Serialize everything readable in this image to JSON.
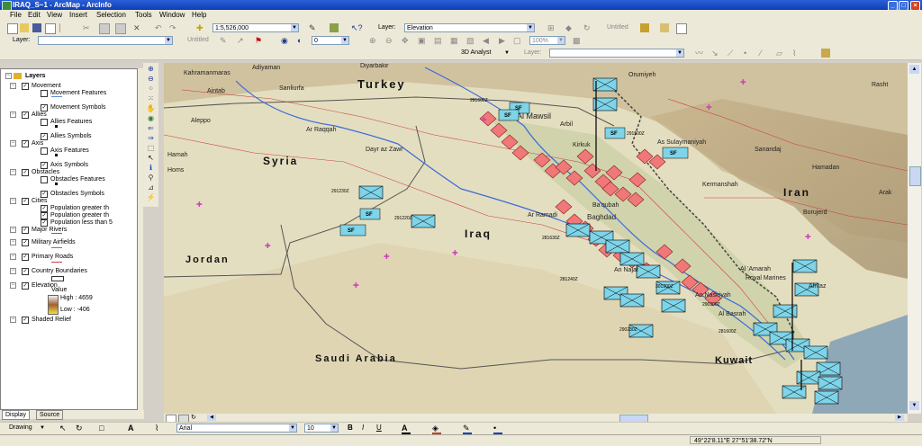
{
  "window": {
    "title": "IRAQ_S~1 - ArcMap - ArcInfo",
    "min": "_",
    "max": "□",
    "close": "×"
  },
  "menu": [
    "File",
    "Edit",
    "View",
    "Insert",
    "Selection",
    "Tools",
    "Window",
    "Help"
  ],
  "standard_toolbar": {
    "scale": "1:5,526,000",
    "layer_label": "Layer:",
    "layer_value": "Elevation",
    "untitled": "Untitled"
  },
  "editor_toolbar": {
    "layer_label": "Layer:",
    "layer_value": "",
    "untitled": "Untitled",
    "band_value": "0",
    "zoom_value": "100%"
  },
  "analyst_toolbar": {
    "name": "3D Analyst",
    "layer_label": "Layer:",
    "layer_value": ""
  },
  "toc": {
    "root": "Layers",
    "items": [
      {
        "label": "Movement",
        "type": "group",
        "checked": true
      },
      {
        "label": "Movement Features",
        "type": "layer",
        "checked": false
      },
      {
        "label": "Movement Symbols",
        "type": "layer",
        "checked": true
      },
      {
        "label": "Allies",
        "type": "group",
        "checked": true
      },
      {
        "label": "Allies Features",
        "type": "layer",
        "checked": false
      },
      {
        "label": "Allies Symbols",
        "type": "layer",
        "checked": true
      },
      {
        "label": "Axis",
        "type": "group",
        "checked": true
      },
      {
        "label": "Axis Features",
        "type": "layer",
        "checked": false
      },
      {
        "label": "Axis Symbols",
        "type": "layer",
        "checked": true
      },
      {
        "label": "Obstacles",
        "type": "group",
        "checked": true
      },
      {
        "label": "Obstacles Features",
        "type": "layer",
        "checked": false
      },
      {
        "label": "Obstacles Symbols",
        "type": "layer",
        "checked": true
      },
      {
        "label": "Cities",
        "type": "group",
        "checked": true
      },
      {
        "label": "Population greater th",
        "type": "layer",
        "checked": true
      },
      {
        "label": "Population greater th",
        "type": "layer",
        "checked": true
      },
      {
        "label": "Population less than 5",
        "type": "layer",
        "checked": true
      },
      {
        "label": "Major Rivers",
        "type": "group",
        "checked": true
      },
      {
        "label": "Military Airfields",
        "type": "group",
        "checked": true
      },
      {
        "label": "Primary Roads",
        "type": "group",
        "checked": true
      },
      {
        "label": "Country Boundaries",
        "type": "group",
        "checked": true
      },
      {
        "label": "Elevation",
        "type": "group",
        "checked": true
      },
      {
        "label": "Shaded Relief",
        "type": "group",
        "checked": true
      }
    ],
    "legend": {
      "value": "Value",
      "high": "High : 4659",
      "low": "Low : -406"
    },
    "tabs": [
      "Display",
      "Source"
    ]
  },
  "map_labels": {
    "countries": [
      "Turkey",
      "Syria",
      "Iraq",
      "Iran",
      "Jordan",
      "Saudi Arabia",
      "Kuwait"
    ],
    "cities": [
      "Kahramanmaras",
      "Adiyaman",
      "Diyarbakir",
      "Aintab",
      "Sanliurfa",
      "Aleppo",
      "Ar Raqqah",
      "Dayr az Zawr",
      "Hamah",
      "Homs",
      "Al Mawsil",
      "Arbil",
      "Kirkuk",
      "Orumiyeh",
      "As Sulaymaniyah",
      "Sanandaj",
      "Hamadan",
      "Kermanshah",
      "Rasht",
      "Arak",
      "Borujerd",
      "Baghdad",
      "Ba'qubah",
      "Ar Ramadi",
      "An Najaf",
      "An Nasiriyah",
      "Al Basrah",
      "Al 'Amarah",
      "Ahvaz",
      "Royal Marines"
    ],
    "unit_tags": [
      "SF",
      "SF",
      "SF",
      "SF",
      "SF",
      "SF"
    ],
    "times": [
      "291230Z",
      "291220Z",
      "281600Z",
      "281630Z",
      "281240Z",
      "301200Z",
      "290300Z",
      "290230Z",
      "281600Z",
      "291500Z"
    ]
  },
  "drawing_toolbar": {
    "drawing_label": "Drawing",
    "font_name": "Arial",
    "font_size": "10",
    "bold": "B",
    "italic": "I",
    "underline": "U"
  },
  "status": {
    "coords": "49°22'8.11\"E  27°51'38.72\"N"
  }
}
